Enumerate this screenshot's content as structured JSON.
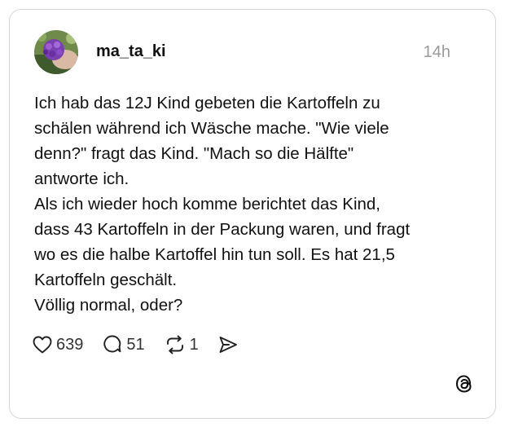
{
  "post": {
    "username": "ma_ta_ki",
    "timestamp": "14h",
    "text": "Ich hab das 12J Kind gebeten die Kartoffeln zu\nschälen während ich Wäsche mache. \"Wie viele\ndenn?\" fragt das Kind. \"Mach so die Hälfte\"\nantworte ich.\nAls ich wieder hoch komme berichtet das Kind,\ndass 43 Kartoffeln in der Packung waren, und fragt\nwo es die halbe Kartoffel hin tun soll. Es hat 21,5\nKartoffeln geschält.\nVöllig normal, oder?"
  },
  "actions": {
    "likes": "639",
    "replies": "51",
    "reposts": "1"
  },
  "icons": {
    "like": "heart-icon",
    "reply": "speech-bubble-icon",
    "repost": "repost-arrows-icon",
    "share": "send-icon",
    "brand": "threads-logo"
  },
  "colors": {
    "text": "#111111",
    "muted": "#9a9a9a",
    "border": "#d6d6d6"
  }
}
